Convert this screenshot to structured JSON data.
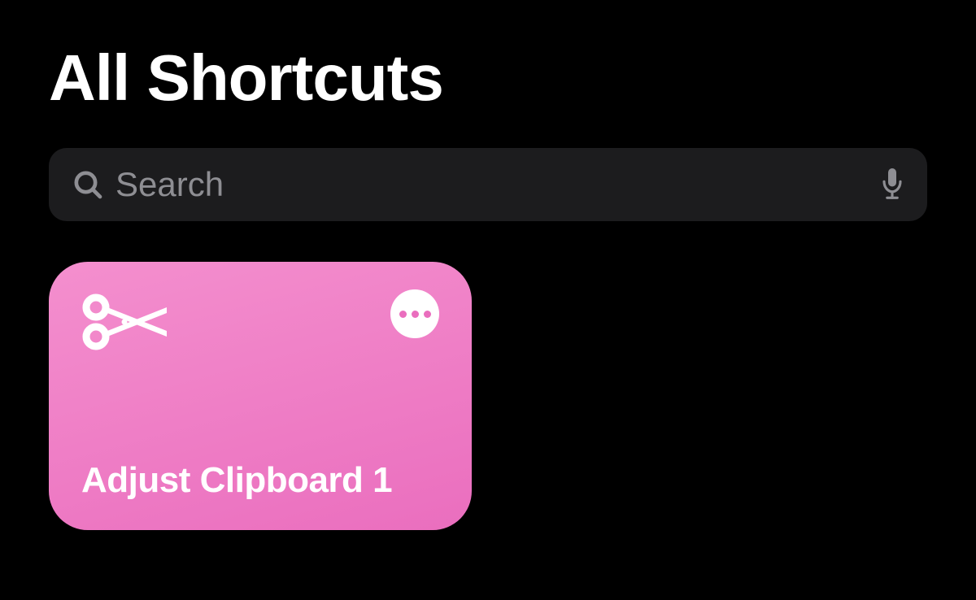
{
  "header": {
    "title": "All Shortcuts"
  },
  "search": {
    "placeholder": "Search",
    "value": ""
  },
  "shortcuts": [
    {
      "label": "Adjust Clipboard 1",
      "icon": "scissors-icon",
      "color": "pink"
    }
  ]
}
